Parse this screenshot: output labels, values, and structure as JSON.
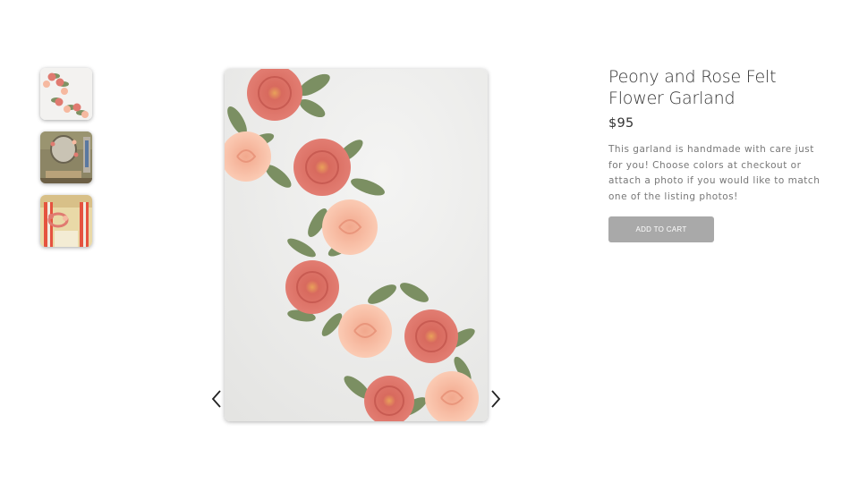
{
  "product": {
    "title": "Peony and Rose Felt Flower Garland",
    "price": "$95",
    "description": "This garland is handmade with care just for you! Choose colors at checkout or attach a photo if you would like to match one of the listing photos!",
    "add_to_cart_label": "ADD TO CART"
  },
  "gallery": {
    "thumbnails": [
      {
        "name": "garland-on-white"
      },
      {
        "name": "garland-around-mirror"
      },
      {
        "name": "garland-on-window"
      }
    ],
    "selected_index": 0
  },
  "colors": {
    "button_bg": "#a9a9a9",
    "title_text": "#333333",
    "description_text": "#777777",
    "peony": "#e07a70",
    "rose": "#f6b9a0",
    "leaf": "#7e9264"
  },
  "icons": {
    "prev": "chevron-left-icon",
    "next": "chevron-right-icon"
  }
}
